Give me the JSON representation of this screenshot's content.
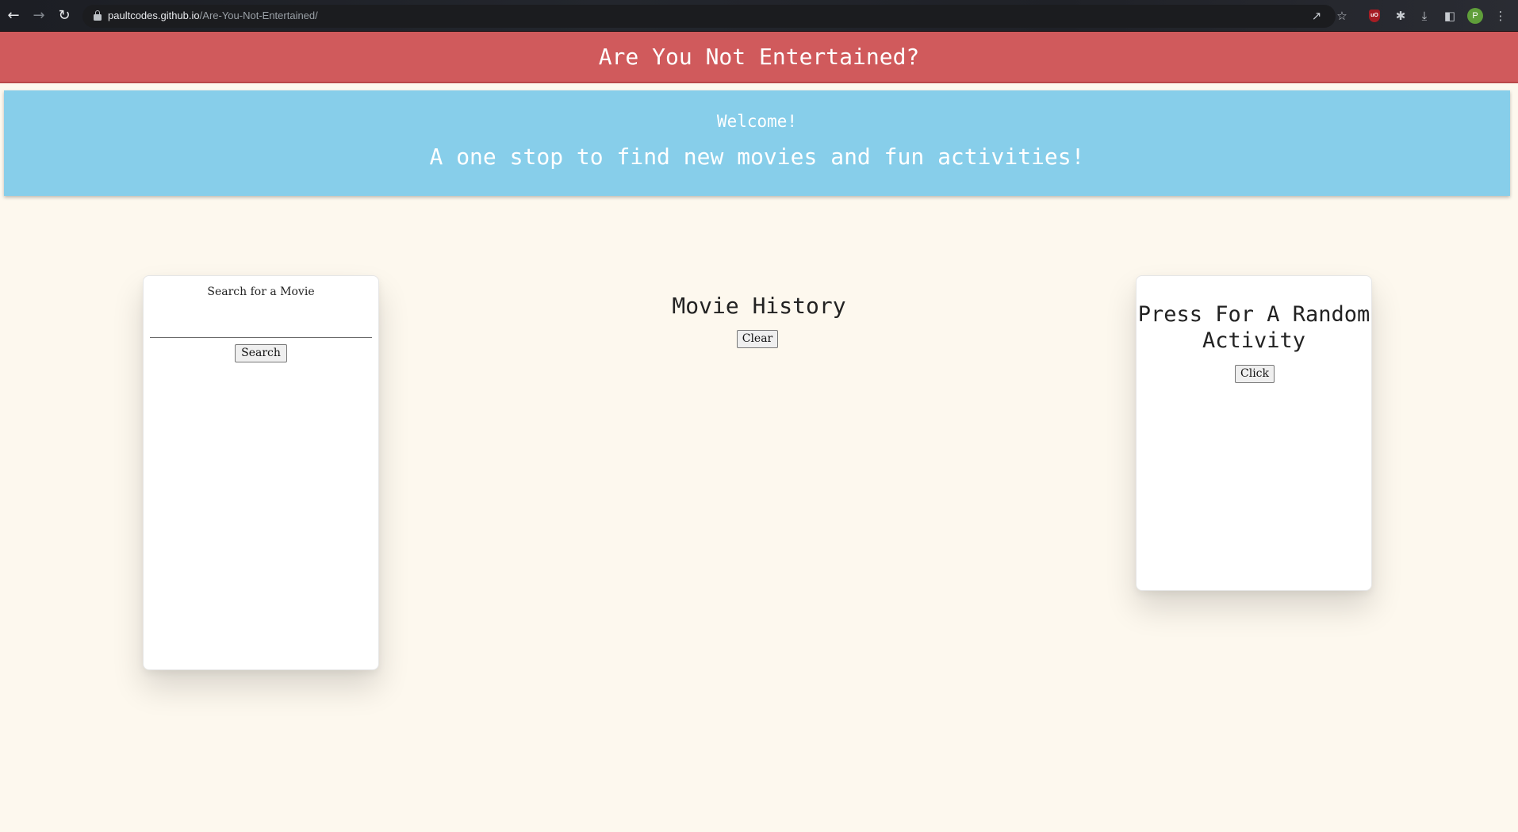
{
  "browser": {
    "url_host": "paultcodes.github.io",
    "url_path": "/Are-You-Not-Entertained/",
    "extension_badge": "uO",
    "profile_initial": "P"
  },
  "header": {
    "title": "Are You Not Entertained?"
  },
  "welcome": {
    "greeting": "Welcome!",
    "tagline": "A one stop to find new movies and fun activities!"
  },
  "search_card": {
    "label": "Search for a Movie",
    "input_value": "",
    "button_label": "Search"
  },
  "history": {
    "title": "Movie History",
    "clear_label": "Clear"
  },
  "activity_card": {
    "title": "Press For A Random Activity",
    "button_label": "Click"
  },
  "colors": {
    "header_bg": "#d05a5c",
    "welcome_bg": "#87ceea",
    "page_bg": "#fdf8ee"
  }
}
